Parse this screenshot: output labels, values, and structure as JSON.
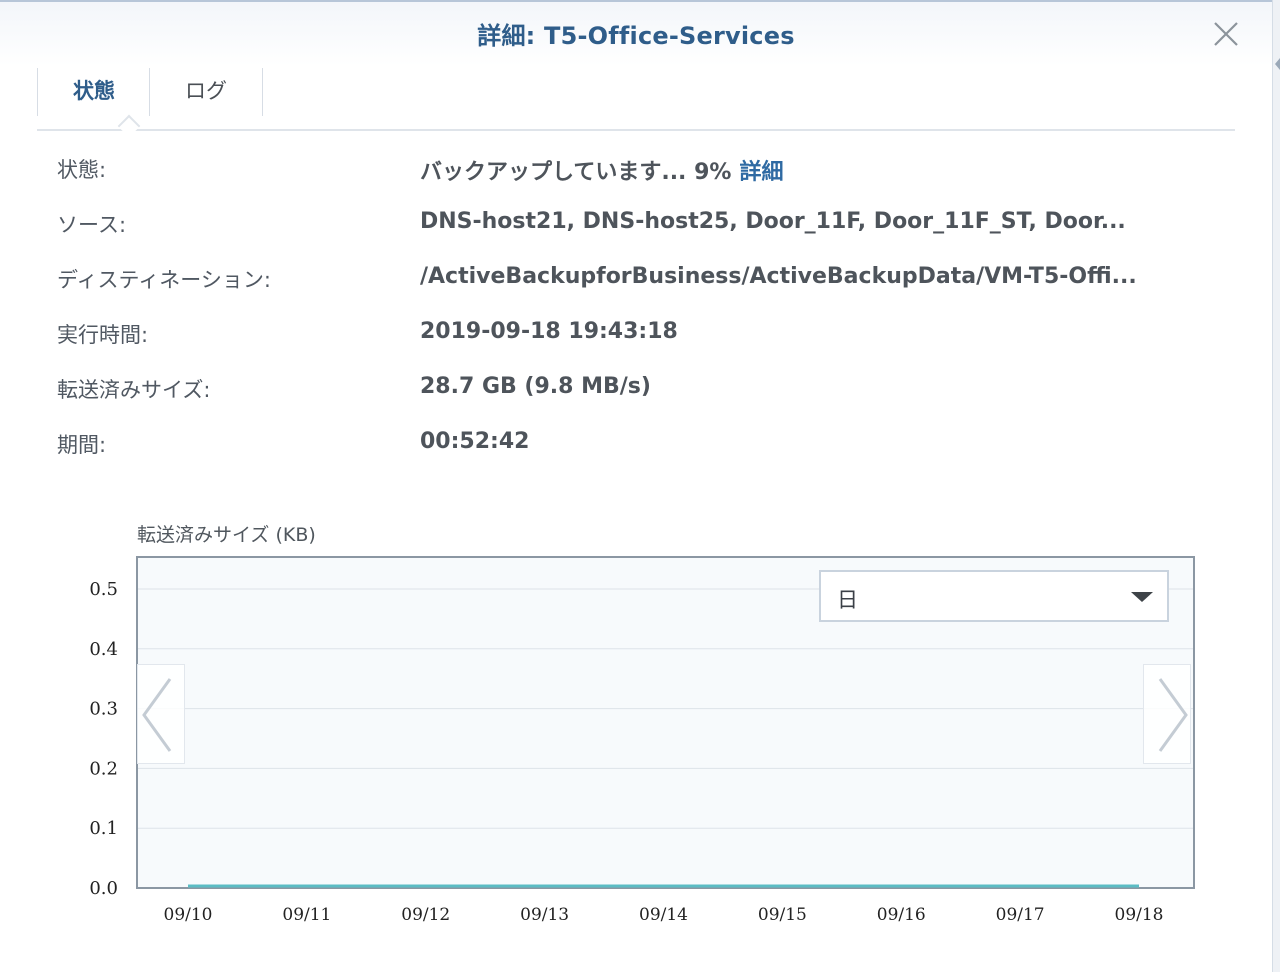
{
  "window": {
    "title": "詳細: T5-Office-Services"
  },
  "tabs": [
    {
      "label": "状態",
      "active": true
    },
    {
      "label": "ログ",
      "active": false
    }
  ],
  "info": {
    "status": {
      "label": "状態:",
      "value": "バックアップしています... 9%",
      "link": "詳細"
    },
    "source": {
      "label": "ソース:",
      "value": "DNS-host21, DNS-host25, Door_11F, Door_11F_ST, Door..."
    },
    "destination": {
      "label": "ディスティネーション:",
      "value": "/ActiveBackupforBusiness/ActiveBackupData/VM-T5-Offi..."
    },
    "run_time": {
      "label": "実行時間:",
      "value": "2019-09-18 19:43:18"
    },
    "transferred": {
      "label": "転送済みサイズ:",
      "value": "28.7 GB (9.8 MB/s)"
    },
    "duration": {
      "label": "期間:",
      "value": "00:52:42"
    }
  },
  "range_select": {
    "selected": "日"
  },
  "icons": {
    "close": "close-icon",
    "prev": "chevron-left-icon",
    "next": "chevron-right-icon",
    "dropdown": "caret-down-icon"
  },
  "colors": {
    "accent": "#2f5d8a",
    "link": "#2f6aa3",
    "line": "#5bbcc4"
  },
  "chart_data": {
    "type": "line",
    "title": "転送済みサイズ (KB)",
    "categories": [
      "09/10",
      "09/11",
      "09/12",
      "09/13",
      "09/14",
      "09/15",
      "09/16",
      "09/17",
      "09/18"
    ],
    "series": [
      {
        "values": [
          0,
          0,
          0,
          0,
          0,
          0,
          0,
          0,
          0
        ]
      }
    ],
    "yticks": [
      "0.0",
      "0.1",
      "0.2",
      "0.3",
      "0.4",
      "0.5"
    ],
    "ylim": [
      0,
      0.5
    ],
    "grid": true
  }
}
